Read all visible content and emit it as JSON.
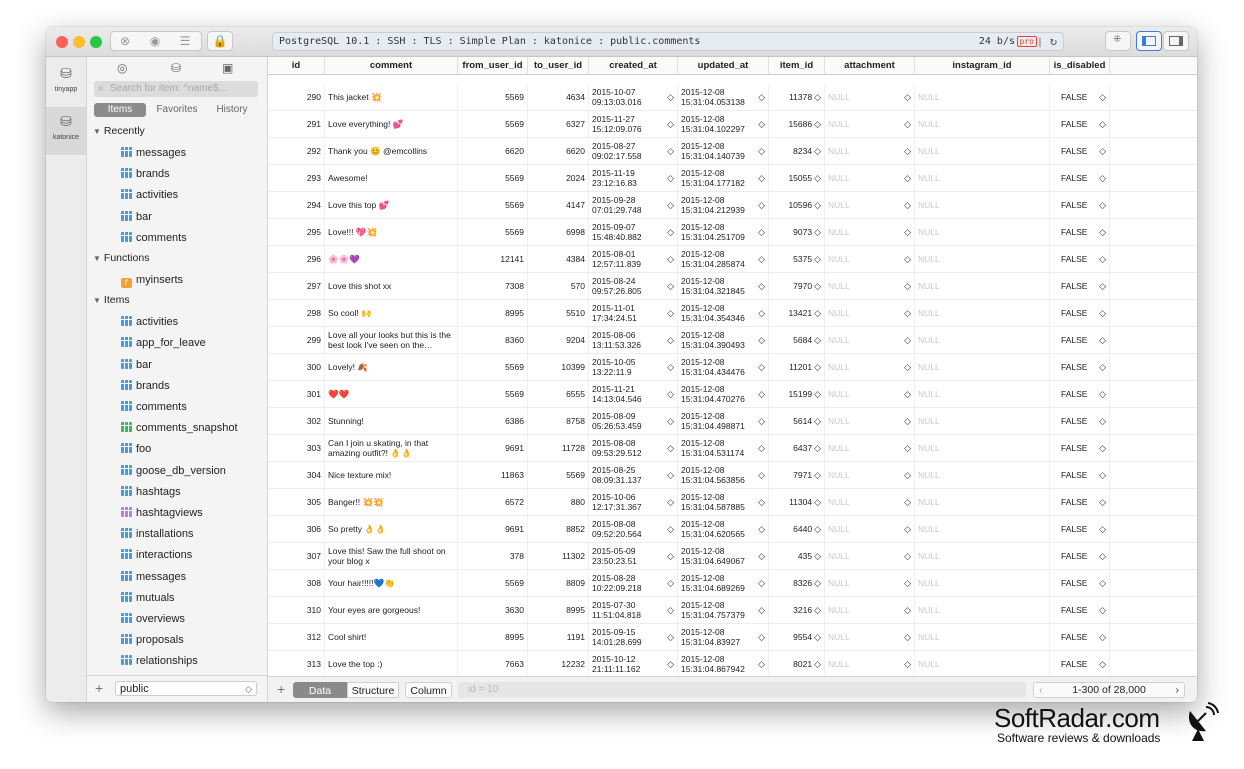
{
  "window": {
    "connection": "PostgreSQL 10.1 : SSH : TLS : Simple Plan : katonice : public.comments",
    "rate": "24 b/s",
    "pro_badge": "pro"
  },
  "rail": [
    {
      "label": "tinyapp",
      "icon": "database-icon"
    },
    {
      "label": "katonice",
      "icon": "database-icon"
    }
  ],
  "sidebar": {
    "search_placeholder": "Search for item: ^name$...",
    "segments": [
      "Items",
      "Favorites",
      "History"
    ],
    "recently_label": "Recently",
    "recently": [
      "messages",
      "brands",
      "activities",
      "bar",
      "comments"
    ],
    "functions_label": "Functions",
    "functions": [
      "myinserts"
    ],
    "items_label": "Items",
    "items": [
      {
        "name": "activities",
        "kind": "table"
      },
      {
        "name": "app_for_leave",
        "kind": "table"
      },
      {
        "name": "bar",
        "kind": "table"
      },
      {
        "name": "brands",
        "kind": "table"
      },
      {
        "name": "comments",
        "kind": "table"
      },
      {
        "name": "comments_snapshot",
        "kind": "green"
      },
      {
        "name": "foo",
        "kind": "table"
      },
      {
        "name": "goose_db_version",
        "kind": "table"
      },
      {
        "name": "hashtags",
        "kind": "table"
      },
      {
        "name": "hashtagviews",
        "kind": "purple"
      },
      {
        "name": "installations",
        "kind": "table"
      },
      {
        "name": "interactions",
        "kind": "table"
      },
      {
        "name": "messages",
        "kind": "table"
      },
      {
        "name": "mutuals",
        "kind": "table"
      },
      {
        "name": "overviews",
        "kind": "table"
      },
      {
        "name": "proposals",
        "kind": "table"
      },
      {
        "name": "relationships",
        "kind": "table"
      }
    ],
    "schema": "public"
  },
  "table": {
    "columns": [
      "id",
      "comment",
      "from_user_id",
      "to_user_id",
      "created_at",
      "updated_at",
      "item_id",
      "attachment",
      "instagram_id",
      "is_disabled"
    ],
    "null_text": "NULL",
    "rows": [
      {
        "id": "290",
        "comment": "This jacket 💥",
        "from": "5569",
        "to": "4634",
        "c1": "2015-10-07",
        "c2": "09:13:03.016",
        "u1": "2015-12-08",
        "u2": "15:31:04.053138",
        "item": "11378",
        "dis": "FALSE"
      },
      {
        "id": "291",
        "comment": "Love everything! 💕",
        "from": "5569",
        "to": "6327",
        "c1": "2015-11-27",
        "c2": "15:12:09.076",
        "u1": "2015-12-08",
        "u2": "15:31:04.102297",
        "item": "15686",
        "dis": "FALSE"
      },
      {
        "id": "292",
        "comment": "Thank you 😊 @emcollins",
        "from": "6620",
        "to": "6620",
        "c1": "2015-08-27",
        "c2": "09:02:17.558",
        "u1": "2015-12-08",
        "u2": "15:31:04.140739",
        "item": "8234",
        "dis": "FALSE"
      },
      {
        "id": "293",
        "comment": "Awesome!",
        "from": "5569",
        "to": "2024",
        "c1": "2015-11-19",
        "c2": "23:12:16.83",
        "u1": "2015-12-08",
        "u2": "15:31:04.177182",
        "item": "15055",
        "dis": "FALSE"
      },
      {
        "id": "294",
        "comment": "Love this top 💕",
        "from": "5569",
        "to": "4147",
        "c1": "2015-09-28",
        "c2": "07:01:29.748",
        "u1": "2015-12-08",
        "u2": "15:31:04.212939",
        "item": "10596",
        "dis": "FALSE"
      },
      {
        "id": "295",
        "comment": "Love!!! 💖💥",
        "from": "5569",
        "to": "6998",
        "c1": "2015-09-07",
        "c2": "15:48:40.882",
        "u1": "2015-12-08",
        "u2": "15:31:04.251709",
        "item": "9073",
        "dis": "FALSE"
      },
      {
        "id": "296",
        "comment": "🌸🌸💜",
        "from": "12141",
        "to": "4384",
        "c1": "2015-08-01",
        "c2": "12:57:11.839",
        "u1": "2015-12-08",
        "u2": "15:31:04.285874",
        "item": "5375",
        "dis": "FALSE"
      },
      {
        "id": "297",
        "comment": "Love this shot xx",
        "from": "7308",
        "to": "570",
        "c1": "2015-08-24",
        "c2": "09:57:26.805",
        "u1": "2015-12-08",
        "u2": "15:31:04.321845",
        "item": "7970",
        "dis": "FALSE"
      },
      {
        "id": "298",
        "comment": "So cool! 🙌",
        "from": "8995",
        "to": "5510",
        "c1": "2015-11-01",
        "c2": "17:34:24.51",
        "u1": "2015-12-08",
        "u2": "15:31:04.354346",
        "item": "13421",
        "dis": "FALSE"
      },
      {
        "id": "299",
        "comment": "Love all your looks but this is the best look I've seen on the…",
        "from": "8360",
        "to": "9204",
        "c1": "2015-08-06",
        "c2": "13:11:53.326",
        "u1": "2015-12-08",
        "u2": "15:31:04.390493",
        "item": "5684",
        "dis": "FALSE"
      },
      {
        "id": "300",
        "comment": "Lovely! 🍂",
        "from": "5569",
        "to": "10399",
        "c1": "2015-10-05",
        "c2": "13:22:11.9",
        "u1": "2015-12-08",
        "u2": "15:31:04.434476",
        "item": "11201",
        "dis": "FALSE"
      },
      {
        "id": "301",
        "comment": "❤️❤️",
        "from": "5569",
        "to": "6555",
        "c1": "2015-11-21",
        "c2": "14:13:04.546",
        "u1": "2015-12-08",
        "u2": "15:31:04.470276",
        "item": "15199",
        "dis": "FALSE"
      },
      {
        "id": "302",
        "comment": "Stunning!",
        "from": "6386",
        "to": "8758",
        "c1": "2015-08-09",
        "c2": "05:26:53.459",
        "u1": "2015-12-08",
        "u2": "15:31:04.498871",
        "item": "5614",
        "dis": "FALSE"
      },
      {
        "id": "303",
        "comment": "Can I join u skating, in that amazing outfit?! 👌👌",
        "from": "9691",
        "to": "11728",
        "c1": "2015-08-08",
        "c2": "09:53:29.512",
        "u1": "2015-12-08",
        "u2": "15:31:04.531174",
        "item": "6437",
        "dis": "FALSE"
      },
      {
        "id": "304",
        "comment": "Nice texture mix!",
        "from": "11863",
        "to": "5569",
        "c1": "2015-08-25",
        "c2": "08:09:31.137",
        "u1": "2015-12-08",
        "u2": "15:31:04.563856",
        "item": "7971",
        "dis": "FALSE"
      },
      {
        "id": "305",
        "comment": "Banger!! 💥💥",
        "from": "6572",
        "to": "880",
        "c1": "2015-10-06",
        "c2": "12:17:31.367",
        "u1": "2015-12-08",
        "u2": "15:31:04.587885",
        "item": "11304",
        "dis": "FALSE"
      },
      {
        "id": "306",
        "comment": "So pretty 👌👌",
        "from": "9691",
        "to": "8852",
        "c1": "2015-08-08",
        "c2": "09:52:20.564",
        "u1": "2015-12-08",
        "u2": "15:31:04.620565",
        "item": "6440",
        "dis": "FALSE"
      },
      {
        "id": "307",
        "comment": "Love this! Saw the full shoot on your blog x",
        "from": "378",
        "to": "11302",
        "c1": "2015-05-09",
        "c2": "23:50:23.51",
        "u1": "2015-12-08",
        "u2": "15:31:04.649067",
        "item": "435",
        "dis": "FALSE"
      },
      {
        "id": "308",
        "comment": "Your hair!!!!!💙👏",
        "from": "5569",
        "to": "8809",
        "c1": "2015-08-28",
        "c2": "10:22:09.218",
        "u1": "2015-12-08",
        "u2": "15:31:04.689269",
        "item": "8326",
        "dis": "FALSE"
      },
      {
        "id": "310",
        "comment": "Your eyes are gorgeous!",
        "from": "3630",
        "to": "8995",
        "c1": "2015-07-30",
        "c2": "11:51:04.818",
        "u1": "2015-12-08",
        "u2": "15:31:04.757379",
        "item": "3216",
        "dis": "FALSE"
      },
      {
        "id": "312",
        "comment": "Cool shirt!",
        "from": "8995",
        "to": "1191",
        "c1": "2015-09-15",
        "c2": "14:01:28.699",
        "u1": "2015-12-08",
        "u2": "15:31:04.83927",
        "item": "9554",
        "dis": "FALSE"
      },
      {
        "id": "313",
        "comment": "Love the top :)",
        "from": "7663",
        "to": "12232",
        "c1": "2015-10-12",
        "c2": "21:11:11.162",
        "u1": "2015-12-08",
        "u2": "15:31:04.867942",
        "item": "8021",
        "dis": "FALSE"
      }
    ]
  },
  "bottom": {
    "tabs": [
      "Data",
      "Structure",
      "Column"
    ],
    "filter_placeholder": "id = 10",
    "pager": "1-300 of 28,000"
  },
  "watermark": {
    "brand": "SoftRadar.com",
    "tagline": "Software reviews & downloads"
  },
  "colors": {
    "close": "#fe5f57",
    "minimize": "#febc2e",
    "zoom": "#28c840",
    "table_icon": "#4a9ae0",
    "active_segment": "#8c8c8c"
  }
}
